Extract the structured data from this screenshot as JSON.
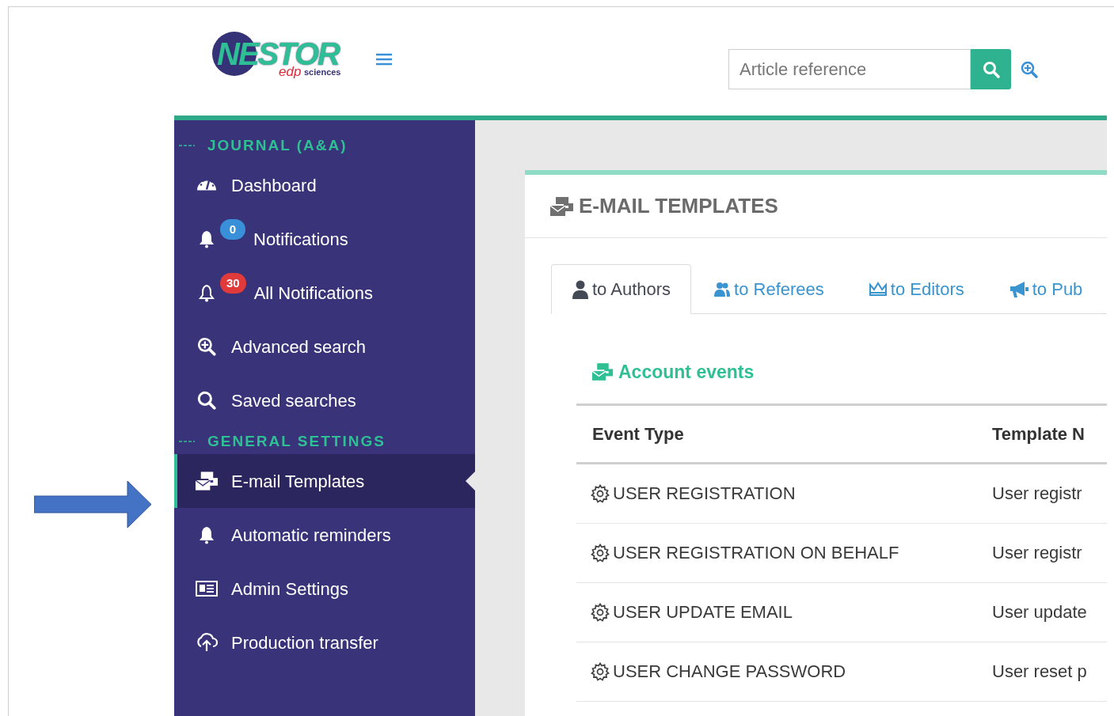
{
  "header": {
    "logo": {
      "title": "NESTOR",
      "brand": "edp",
      "brand_suffix": "sciences"
    },
    "search": {
      "placeholder": "Article reference"
    }
  },
  "sidebar": {
    "sections": [
      {
        "title": "JOURNAL (A&A)",
        "items": [
          {
            "label": "Dashboard",
            "selected": false
          },
          {
            "label": "Notifications",
            "badge": "0",
            "color": "#3a8fd9",
            "selected": false
          },
          {
            "label": "All Notifications",
            "badge": "30",
            "color": "#e03a3a",
            "selected": false
          },
          {
            "label": "Advanced search",
            "selected": false
          },
          {
            "label": "Saved searches",
            "selected": false
          }
        ]
      },
      {
        "title": "GENERAL SETTINGS",
        "items": [
          {
            "label": "E-mail Templates",
            "selected": true
          },
          {
            "label": "Automatic reminders",
            "selected": false
          },
          {
            "label": "Admin Settings",
            "selected": false
          },
          {
            "label": "Production transfer",
            "selected": false
          }
        ]
      }
    ]
  },
  "card": {
    "title": "E-MAIL TEMPLATES",
    "tabs": [
      {
        "label": "to Authors",
        "selected": true
      },
      {
        "label": "to Referees",
        "selected": false
      },
      {
        "label": "to Editors",
        "selected": false
      },
      {
        "label": "to Pub",
        "selected": false
      }
    ],
    "section_title": "Account events",
    "table": {
      "columns": [
        "Event Type",
        "Template N"
      ],
      "rows": [
        [
          "USER REGISTRATION",
          "User registr"
        ],
        [
          "USER REGISTRATION ON BEHALF",
          "User registr"
        ],
        [
          "USER UPDATE EMAIL",
          "User update"
        ],
        [
          "USER CHANGE PASSWORD",
          "User reset p"
        ]
      ]
    }
  }
}
